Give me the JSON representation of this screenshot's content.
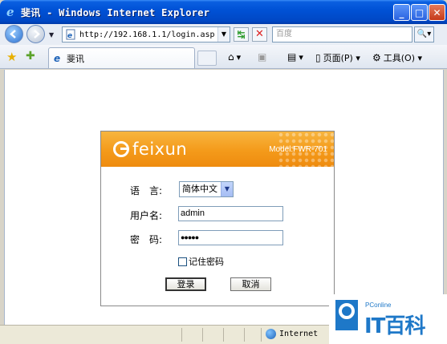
{
  "window": {
    "title": "斐讯 - Windows Internet Explorer",
    "minimize": "_",
    "maximize": "□",
    "close": "✕"
  },
  "address": {
    "url": "http://192.168.1.1/login.asp",
    "search_placeholder": "百度"
  },
  "tabs": [
    {
      "label": "斐讯"
    }
  ],
  "commands": {
    "page": "页面(P)",
    "tools": "工具(O)"
  },
  "login": {
    "brand": "feixun",
    "model": "Model:FWR-701",
    "language_label": "语　言:",
    "language_value": "简体中文",
    "username_label": "用户名:",
    "username_value": "admin",
    "password_label": "密　码:",
    "password_value": "●●●●●",
    "remember_label": "记住密码",
    "login_button": "登录",
    "cancel_button": "取消"
  },
  "status": {
    "zone": "Internet"
  },
  "watermark": {
    "small": "PConline",
    "big": "IT百科"
  }
}
